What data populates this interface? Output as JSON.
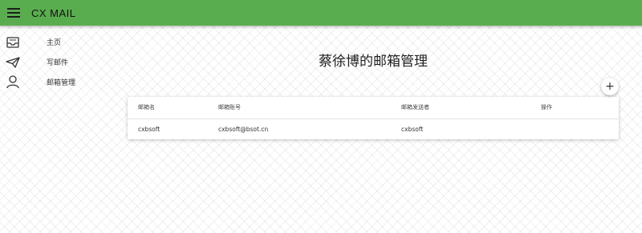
{
  "app": {
    "title": "CX MAIL"
  },
  "sidebar": {
    "items": [
      {
        "icon": "inbox-icon",
        "label": "主页"
      },
      {
        "icon": "send-icon",
        "label": "写邮件"
      },
      {
        "icon": "person-icon",
        "label": "邮箱管理"
      }
    ]
  },
  "main": {
    "title": "蔡徐博的邮箱管理",
    "add_icon": "+",
    "table": {
      "columns": [
        "邮箱名",
        "邮箱账号",
        "邮箱发送者",
        "操作"
      ],
      "rows": [
        {
          "name": "cxbsoft",
          "account": "cxbsoft@bsot.cn",
          "sender": "cxbsoft",
          "action": ""
        }
      ]
    }
  },
  "colors": {
    "appbar": "#5aad4f"
  }
}
